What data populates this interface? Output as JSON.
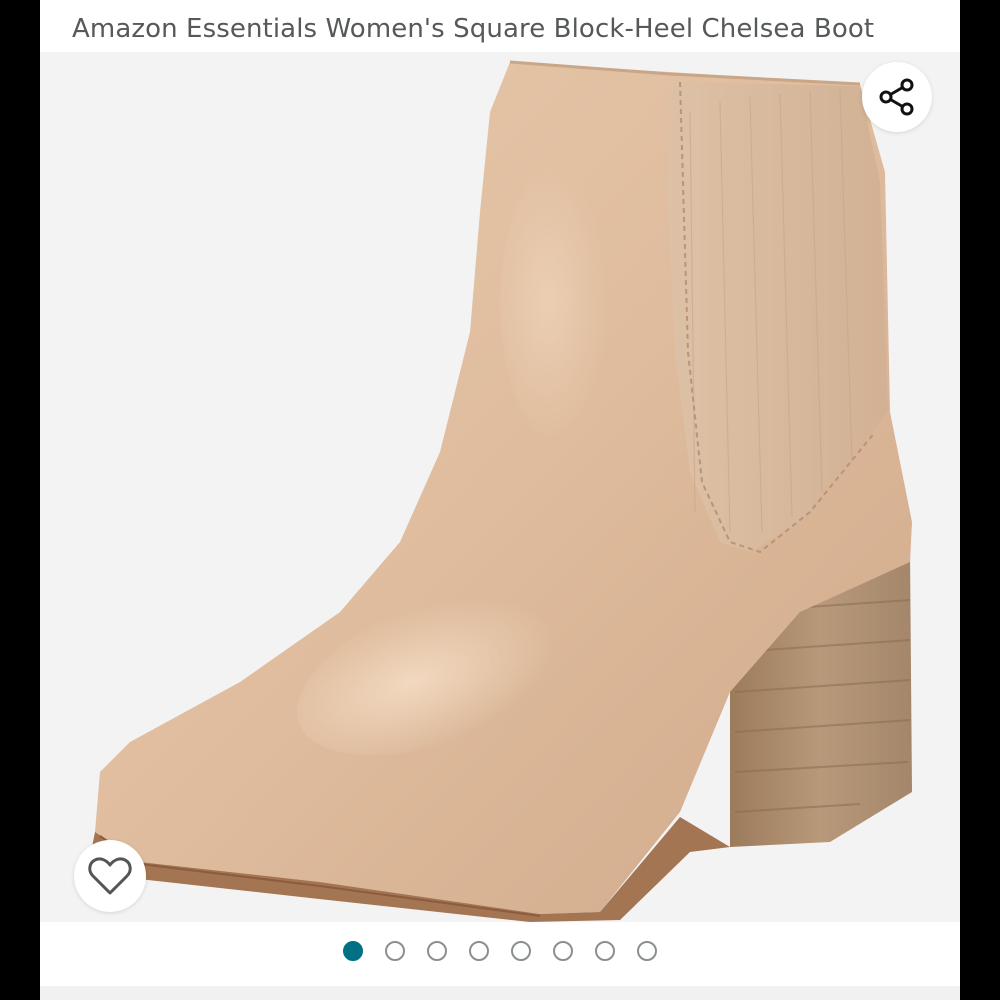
{
  "product": {
    "title": "Amazon Essentials Women's Square Block-Heel Chelsea Boot"
  },
  "gallery": {
    "image_subject": "Tan leather Chelsea ankle boot with stacked wood block heel",
    "image_count": 8,
    "active_index": 0,
    "share_icon": "share-icon",
    "wishlist_icon": "heart-outline-icon"
  },
  "colors": {
    "accent": "#007185",
    "leather": "#e0bc9e",
    "heel": "#a98b6c",
    "background": "#f3f3f3"
  }
}
